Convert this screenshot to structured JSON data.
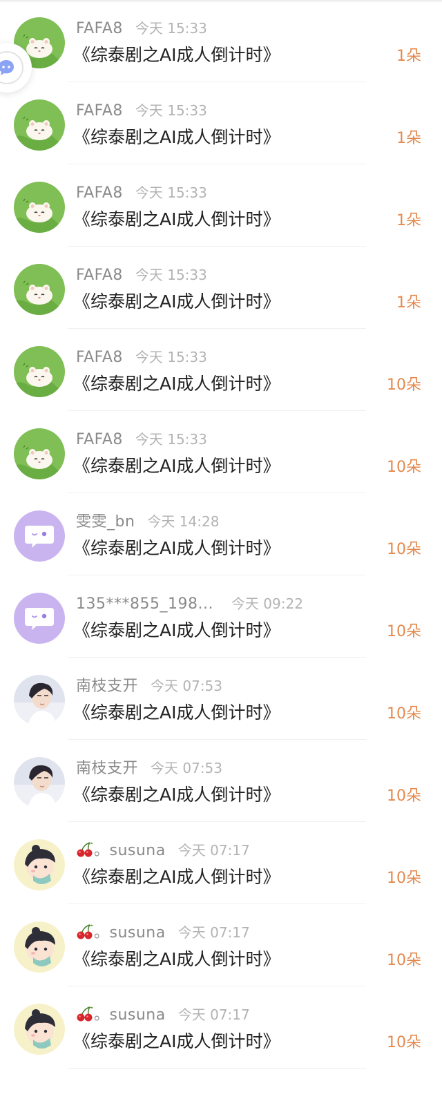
{
  "gift_list": {
    "items": [
      {
        "user": "FAFA8",
        "time": "今天 15:33",
        "title": "《综泰剧之AI成人倒计时》",
        "gift": "1朵",
        "avatar": "hamster-avatar-icon"
      },
      {
        "user": "FAFA8",
        "time": "今天 15:33",
        "title": "《综泰剧之AI成人倒计时》",
        "gift": "1朵",
        "avatar": "hamster-avatar-icon"
      },
      {
        "user": "FAFA8",
        "time": "今天 15:33",
        "title": "《综泰剧之AI成人倒计时》",
        "gift": "1朵",
        "avatar": "hamster-avatar-icon"
      },
      {
        "user": "FAFA8",
        "time": "今天 15:33",
        "title": "《综泰剧之AI成人倒计时》",
        "gift": "1朵",
        "avatar": "hamster-avatar-icon"
      },
      {
        "user": "FAFA8",
        "time": "今天 15:33",
        "title": "《综泰剧之AI成人倒计时》",
        "gift": "10朵",
        "avatar": "hamster-avatar-icon"
      },
      {
        "user": "FAFA8",
        "time": "今天 15:33",
        "title": "《综泰剧之AI成人倒计时》",
        "gift": "10朵",
        "avatar": "hamster-avatar-icon"
      },
      {
        "user": "雯雯_bn",
        "time": "今天 14:28",
        "title": "《综泰剧之AI成人倒计时》",
        "gift": "10朵",
        "avatar": "default-chat-avatar-icon"
      },
      {
        "user": "135***855_198...",
        "time": "今天 09:22",
        "title": "《综泰剧之AI成人倒计时》",
        "gift": "10朵",
        "avatar": "default-chat-avatar-icon"
      },
      {
        "user": "南枝支开",
        "time": "今天 07:53",
        "title": "《综泰剧之AI成人倒计时》",
        "gift": "10朵",
        "avatar": "portrait-avatar-icon"
      },
      {
        "user": "南枝支开",
        "time": "今天 07:53",
        "title": "《综泰剧之AI成人倒计时》",
        "gift": "10朵",
        "avatar": "portrait-avatar-icon"
      },
      {
        "user": "。susuna",
        "time": "今天 07:17",
        "title": "《综泰剧之AI成人倒计时》",
        "gift": "10朵",
        "avatar": "cartoon-boy-avatar-icon",
        "prefix_icon": "cherry-icon"
      },
      {
        "user": "。susuna",
        "time": "今天 07:17",
        "title": "《综泰剧之AI成人倒计时》",
        "gift": "10朵",
        "avatar": "cartoon-boy-avatar-icon",
        "prefix_icon": "cherry-icon"
      },
      {
        "user": "。susuna",
        "time": "今天 07:17",
        "title": "《综泰剧之AI成人倒计时》",
        "gift": "10朵",
        "avatar": "cartoon-boy-avatar-icon",
        "prefix_icon": "cherry-icon"
      }
    ]
  },
  "floating_button": {
    "icon": "assistant-bubble-icon"
  },
  "colors": {
    "gift_text": "#e4894d",
    "username": "#8a8a8a",
    "timestamp": "#b3b3b3",
    "title_text": "#222222",
    "hamster_bg": "#7fbf55",
    "default_avatar_bg": "#c9b4f0"
  }
}
